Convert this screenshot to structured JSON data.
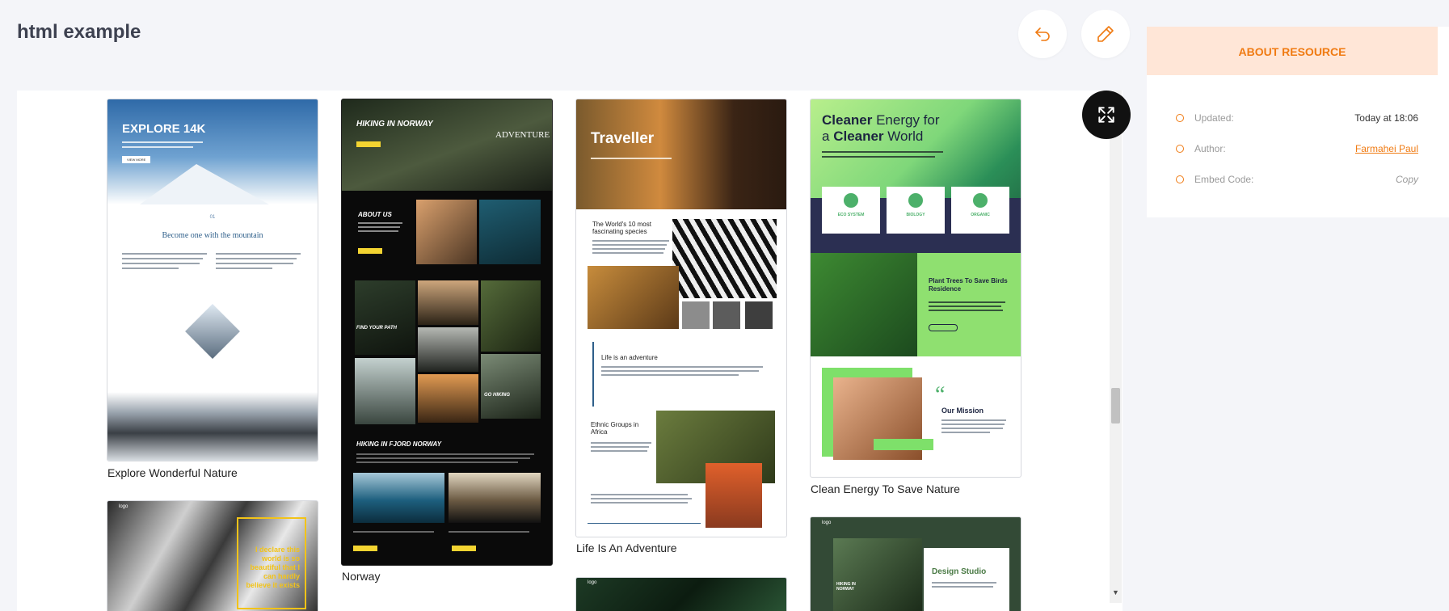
{
  "page": {
    "title": "html example"
  },
  "toolbar": {
    "undo_icon": "undo-icon",
    "edit_icon": "pencil-icon",
    "fullscreen_icon": "expand-icon"
  },
  "templates": [
    {
      "caption": "Explore Wonderful Nature",
      "thumb": {
        "hero_title": "EXPLORE 14K",
        "hero_button": "VIEW MORE",
        "number": "01",
        "subheading": "Become one with the mountain"
      }
    },
    {
      "caption": "Norway",
      "thumb": {
        "hero_title": "HIKING IN NORWAY",
        "badge": "ADVENTURE",
        "section1": "ABOUT US",
        "section2": "FIND YOUR PATH",
        "section3": "GO HIKING",
        "section4": "HIKING IN FJORD NORWAY"
      }
    },
    {
      "caption": "Life Is An Adventure",
      "thumb": {
        "hero_title": "Traveller",
        "section1": "The World's 10 most fascinating species",
        "section2": "Life is an adventure",
        "section3": "Ethnic Groups in Africa"
      }
    },
    {
      "caption": "Clean Energy To Save Nature",
      "thumb": {
        "hero_title_a": "Cleaner",
        "hero_title_b": " Energy for",
        "hero_title_c": "a ",
        "hero_title_d": "Cleaner",
        "hero_title_e": " World",
        "cards": [
          "ECO SYSTEM",
          "BIOLOGY",
          "ORGANIC"
        ],
        "section1": "Plant Trees To Save Birds Residence",
        "section2": "Our Mission"
      }
    },
    {
      "caption": "",
      "thumb": {
        "logo": "logo",
        "quote": "I declare this world is so beautiful that I can hardly believe it exists"
      }
    },
    {
      "caption": "",
      "thumb": {
        "logo": "logo"
      }
    },
    {
      "caption": "",
      "thumb": {
        "logo": "logo",
        "title": "Design Studio",
        "sub": "HIKING IN NORWAY"
      }
    }
  ],
  "about": {
    "header": "ABOUT RESOURCE",
    "rows": [
      {
        "label": "Updated:",
        "value": "Today at 18:06"
      },
      {
        "label": "Author:",
        "value": "Farmahei Paul"
      },
      {
        "label": "Embed Code:",
        "value": "Copy"
      }
    ]
  },
  "colors": {
    "accent": "#f07b13",
    "accent_bg": "#ffe6d7",
    "page_bg": "#f4f5f9"
  }
}
